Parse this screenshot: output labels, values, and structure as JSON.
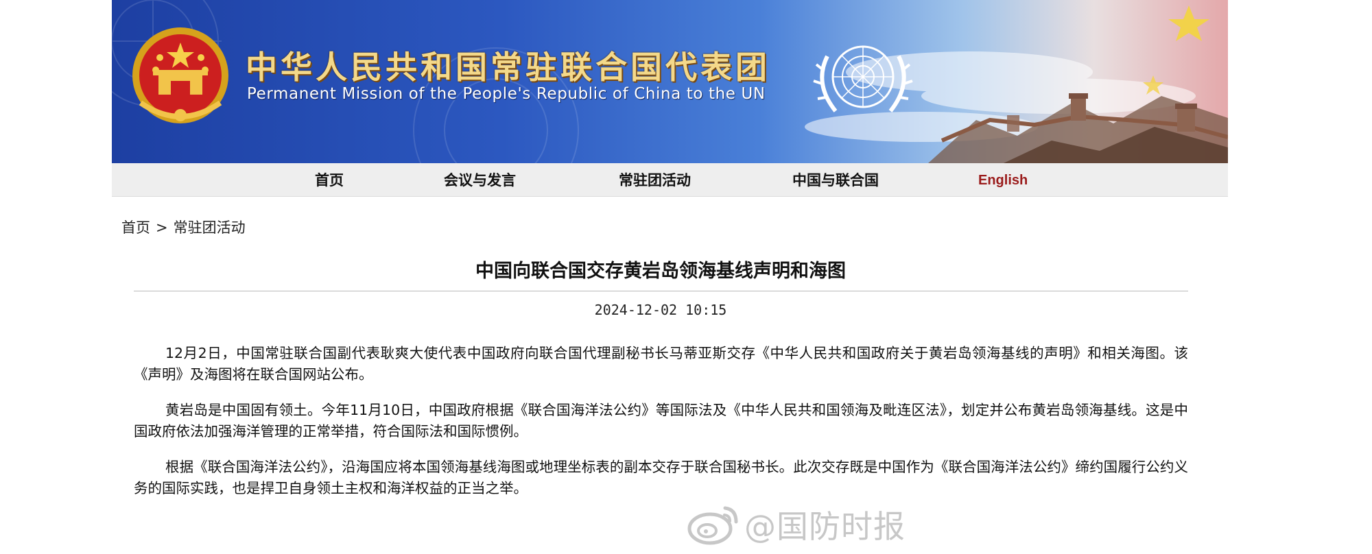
{
  "header": {
    "title_cn": "中华人民共和国常驻联合国代表团",
    "title_en": "Permanent Mission of the People's Republic of China to the UN",
    "emblem_icon": "national-emblem-icon",
    "un_icon": "un-emblem-icon"
  },
  "nav": {
    "items": [
      {
        "label": "首页"
      },
      {
        "label": "会议与发言"
      },
      {
        "label": "常驻团活动"
      },
      {
        "label": "中国与联合国"
      },
      {
        "label": "English"
      }
    ]
  },
  "breadcrumb": {
    "home": "首页",
    "separator": ">",
    "current": "常驻团活动"
  },
  "article": {
    "title": "中国向联合国交存黄岩岛领海基线声明和海图",
    "date": "2024-12-02 10:15",
    "paragraphs": [
      "12月2日，中国常驻联合国副代表耿爽大使代表中国政府向联合国代理副秘书长马蒂亚斯交存《中华人民共和国政府关于黄岩岛领海基线的声明》和相关海图。该《声明》及海图将在联合国网站公布。",
      "黄岩岛是中国固有领土。今年11月10日，中国政府根据《联合国海洋法公约》等国际法及《中华人民共和国领海及毗连区法》，划定并公布黄岩岛领海基线。这是中国政府依法加强海洋管理的正常举措，符合国际法和国际惯例。",
      "根据《联合国海洋法公约》，沿海国应将本国领海基线海图或地理坐标表的副本交存于联合国秘书长。此次交存既是中国作为《联合国海洋法公约》缔约国履行公约义务的国际实践，也是捍卫自身领土主权和海洋权益的正当之举。"
    ]
  },
  "watermark": {
    "text": "@国防时报",
    "icon": "weibo-logo-icon"
  },
  "colors": {
    "banner_blue": "#1d3fa2",
    "title_gold": "#f4d98a",
    "nav_bg": "#eeeeee",
    "english_link": "#9a1b1b"
  }
}
